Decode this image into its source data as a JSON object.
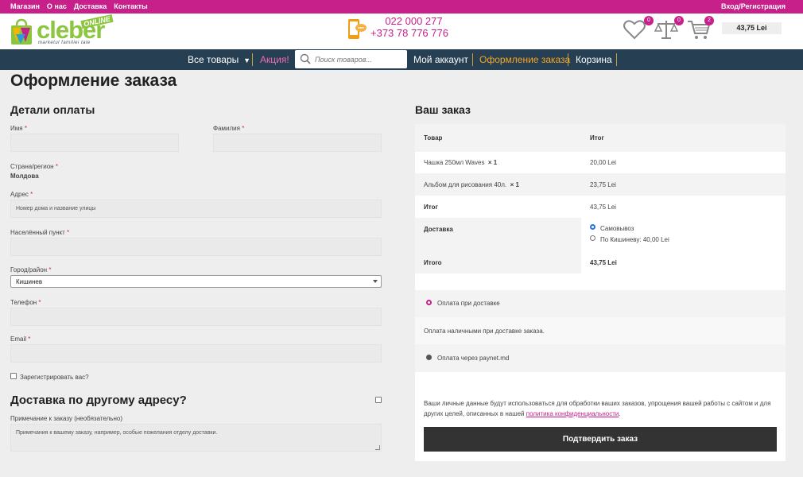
{
  "topbar": {
    "links": [
      "Магазин",
      "О нас",
      "Доставка",
      "Контакты"
    ],
    "login": "Вход/Регистрация"
  },
  "brand": {
    "name": "cleber",
    "online": "ONLINE",
    "tagline": "marketul familiei tale",
    "accent": "#c8208a",
    "green": "#8cc63f",
    "nav_bg": "#263f52"
  },
  "contacts": {
    "phone1": "022 000 277",
    "phone2": "+373 78 776 776"
  },
  "header_icons": {
    "wishlist": {
      "icon": "heart-icon",
      "count": "0"
    },
    "compare": {
      "icon": "scales-icon",
      "count": "0"
    },
    "cart": {
      "icon": "cart-icon",
      "count": "2"
    },
    "cart_total": "43,75 Lei"
  },
  "nav": {
    "all_products": "Все товары",
    "promo": "Акция!",
    "search_placeholder": "Поиск товаров...",
    "account": "Мой аккаунт",
    "checkout": "Оформление заказа",
    "cart": "Корзина"
  },
  "page": {
    "title": "Оформление заказа"
  },
  "billing": {
    "title": "Детали оплаты",
    "first_name_label": "Имя",
    "last_name_label": "Фамилия",
    "country_label": "Страна/регион",
    "country_value": "Молдова",
    "address_label": "Адрес",
    "address_placeholder": "Номер дома и название улицы",
    "locality_label": "Населённый пункт",
    "city_label": "Город/район",
    "city_value": "Кишинев",
    "phone_label": "Телефон",
    "email_label": "Email",
    "register_label": "Зарегистрировать вас?",
    "required_mark": "*"
  },
  "shipping": {
    "title": "Доставка по другому адресу?",
    "notes_label": "Примечание к заказу (необязательно)",
    "notes_placeholder": "Примечания к вашему заказу, например, особые пожелания отделу доставки."
  },
  "order": {
    "title": "Ваш заказ",
    "col_product": "Товар",
    "col_total": "Итог",
    "items": [
      {
        "name": "Чашка 250мл Waves",
        "qty": "× 1",
        "price": "20,00 Lei"
      },
      {
        "name": "Альбом для рисования 40л.",
        "qty": "× 1",
        "price": "23,75 Lei"
      }
    ],
    "subtotal_label": "Итог",
    "subtotal_value": "43,75 Lei",
    "delivery_label": "Доставка",
    "delivery_opt1": "Самовывоз",
    "delivery_opt2": "По Кишиневу: 40,00 Lei",
    "total_label": "Итого",
    "total_value": "43,75 Lei"
  },
  "payment": {
    "cod_label": "Оплата при доставке",
    "cod_desc": "Оплата наличными при доставке заказа.",
    "paynet_label": "Оплата через paynet.md",
    "privacy_text": "Ваши личные данные будут использоваться для обработки ваших заказов, упрощения вашей работы с сайтом и для других целей, описанных в нашей",
    "privacy_link": "политика конфиденциальности",
    "privacy_end": ".",
    "confirm": "Подтвердить заказ"
  }
}
